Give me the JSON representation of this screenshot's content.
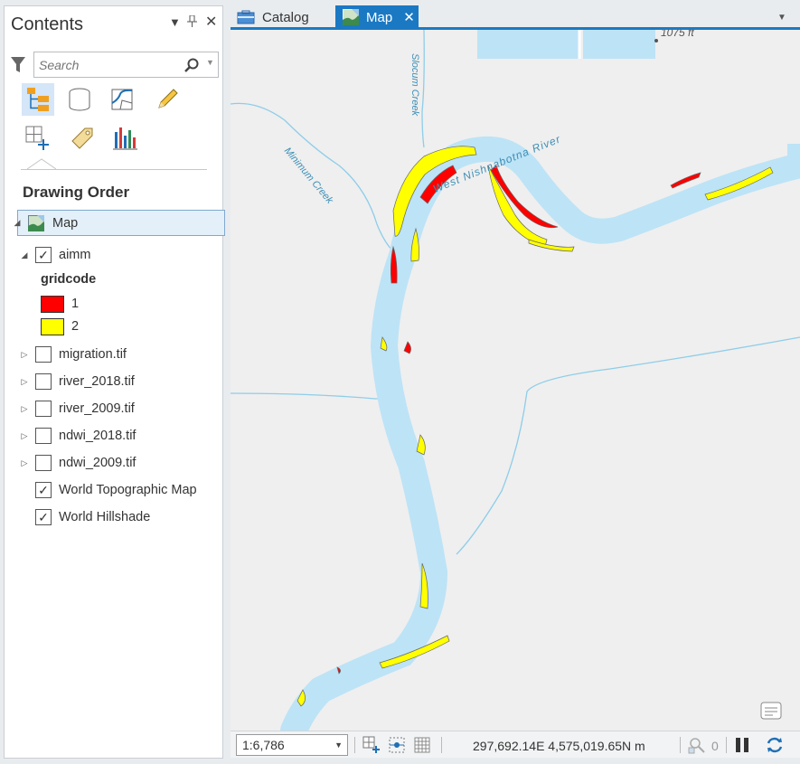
{
  "contents": {
    "title": "Contents",
    "search": {
      "placeholder": "Search"
    },
    "drawing_order_label": "Drawing Order",
    "map_item": "Map",
    "legend_heading": "gridcode",
    "layers": [
      {
        "name": "aimm",
        "checked": true,
        "expanded": true
      },
      {
        "name": "migration.tif",
        "checked": false,
        "expanded": false
      },
      {
        "name": "river_2018.tif",
        "checked": false,
        "expanded": false
      },
      {
        "name": "river_2009.tif",
        "checked": false,
        "expanded": false
      },
      {
        "name": "ndwi_2018.tif",
        "checked": false,
        "expanded": false
      },
      {
        "name": "ndwi_2009.tif",
        "checked": false,
        "expanded": false
      },
      {
        "name": "World Topographic Map",
        "checked": true
      },
      {
        "name": "World Hillshade",
        "checked": true
      }
    ],
    "legend": [
      {
        "label": "1",
        "color": "#ff0000"
      },
      {
        "label": "2",
        "color": "#ffff00"
      }
    ]
  },
  "tabs": [
    {
      "label": "Catalog",
      "active": false
    },
    {
      "label": "Map",
      "active": true
    }
  ],
  "map": {
    "labels": {
      "river": "West Nishnabotna River",
      "creek_a": "Slocum Creek",
      "creek_b": "Minimum Creek",
      "elevation": "1075 ft"
    },
    "colors": {
      "river": "#bde3f6",
      "stream": "#8ecde9",
      "background": "#efefef",
      "class1": "#ff0000",
      "class2": "#ffff00"
    }
  },
  "status": {
    "scale": "1:6,786",
    "coordinates": "297,692.14E 4,575,019.65N m",
    "selected_count": "0"
  },
  "accent": "#1b79c3"
}
